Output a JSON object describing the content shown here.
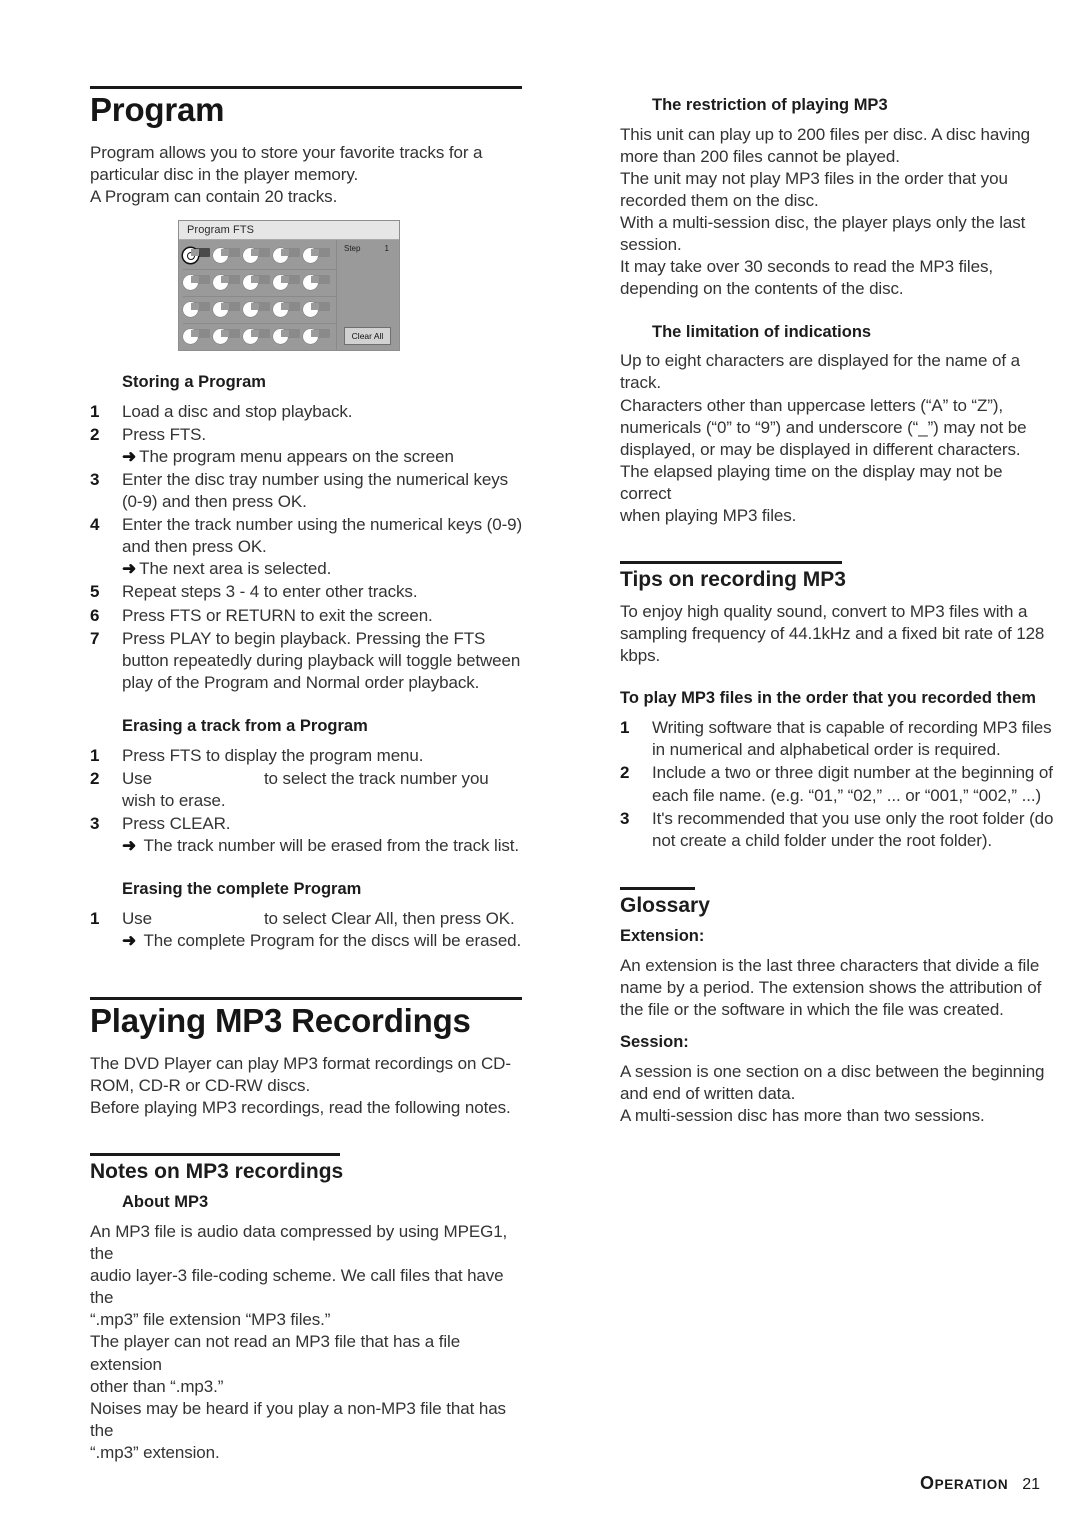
{
  "footer": {
    "section_label": "OPERATION",
    "page_number": "21"
  },
  "left_column": {
    "chapter_title": "Program",
    "intro": "Program allows you to store your favorite tracks for a\nparticular disc in the player memory.\nA Program can contain 20 tracks.",
    "figure": {
      "title": "Program FTS",
      "step_label": "Step",
      "step_value": "1",
      "clear_all_label": "Clear All",
      "grid_rows": 4,
      "grid_cols": 5
    },
    "storing": {
      "heading": "Storing a Program",
      "steps": [
        {
          "num": "1",
          "text": "Load a disc and stop playback."
        },
        {
          "num": "2",
          "text": "Press FTS.",
          "arrow": "The program menu appears on the screen"
        },
        {
          "num": "3",
          "text": "Enter the disc tray number using the numerical keys (0-9) and then press OK."
        },
        {
          "num": "4",
          "text": "Enter the track number using the numerical keys (0-9) and then press OK.",
          "arrow": "The next area is selected."
        },
        {
          "num": "5",
          "text": "Repeat steps 3 - 4 to enter other tracks."
        },
        {
          "num": "6",
          "text": "Press FTS or RETURN to exit the screen."
        },
        {
          "num": "7",
          "text": "Press PLAY to begin playback. Pressing the FTS button repeatedly during playback will toggle between play of the Program and Normal order playback."
        }
      ]
    },
    "erasing_track": {
      "heading": "Erasing a track from a Program",
      "steps": [
        {
          "num": "1",
          "text": "Press FTS to display the program menu."
        },
        {
          "num": "2",
          "text_before": "Use",
          "text_after": "to select the track number you wish to erase."
        },
        {
          "num": "3",
          "text": "Press CLEAR.",
          "arrow": "The track number will be erased from the track list."
        }
      ]
    },
    "erasing_complete": {
      "heading": "Erasing the complete Program",
      "steps": [
        {
          "num": "1",
          "text_before": "Use",
          "text_after": "to select Clear All, then press OK.",
          "arrow": "The complete Program for the discs will be erased."
        }
      ]
    },
    "mp3_chapter_title": "Playing MP3 Recordings",
    "mp3_intro": "The DVD Player can play MP3 format recordings on CD-\nROM, CD-R or CD-RW discs.\nBefore playing MP3 recordings, read the following notes.",
    "notes_heading": "Notes on MP3 recordings",
    "about_mp3": {
      "heading": "About MP3",
      "body": "An MP3 file is audio data compressed by using MPEG1, the\naudio layer-3 file-coding scheme. We call files that have the\n“.mp3” file extension “MP3 files.”\nThe player can not read an MP3 file that has a file extension\nother than “.mp3.”\nNoises may be heard if you play a non-MP3 file that has the\n“.mp3” extension."
    }
  },
  "right_column": {
    "restriction": {
      "heading": "The restriction of playing MP3",
      "body": "This unit can play up to 200 files per disc. A disc having\nmore than 200 files cannot be played.\nThe unit may not play MP3 files in the order that you\nrecorded them on the disc.\nWith a multi-session disc, the player plays only the last\nsession.\nIt may take over 30 seconds to read the MP3 files,\ndepending on the contents of the disc."
    },
    "limitation": {
      "heading": "The limitation of indications",
      "body": "Up to eight characters are displayed for the name of a\ntrack.\nCharacters other than uppercase letters (“A” to “Z”),\nnumericals (“0” to “9”) and underscore (“_”) may not be\ndisplayed, or may be displayed in different characters.\nThe elapsed playing time on the display may not be correct\nwhen playing MP3 files."
    },
    "tips": {
      "heading": "Tips on recording MP3",
      "body": "To enjoy high quality sound, convert to MP3 files with a\nsampling frequency of 44.1kHz and a fixed bit rate of 128\nkbps."
    },
    "order": {
      "heading": "To play MP3 files in the order that you recorded them",
      "steps": [
        {
          "num": "1",
          "text": "Writing software that is capable of recording MP3 files in numerical and alphabetical order is required."
        },
        {
          "num": "2",
          "text": "Include a two or three digit number at the beginning of each file name. (e.g. “01,”  “02,” ... or “001,”  “002,” ...)"
        },
        {
          "num": "3",
          "text": "It's recommended that you use only the root folder (do not create a child folder under the root folder)."
        }
      ]
    },
    "glossary": {
      "heading": "Glossary",
      "entries": [
        {
          "term": "Extension:",
          "body": "An extension is the last three characters that divide a file\nname by a period. The extension shows the attribution of\nthe file or the software in which the file was created."
        },
        {
          "term": "Session:",
          "body": "A session is one section on a disc between the beginning\nand end of written data.\nA multi-session disc has more than two sessions."
        }
      ]
    }
  }
}
